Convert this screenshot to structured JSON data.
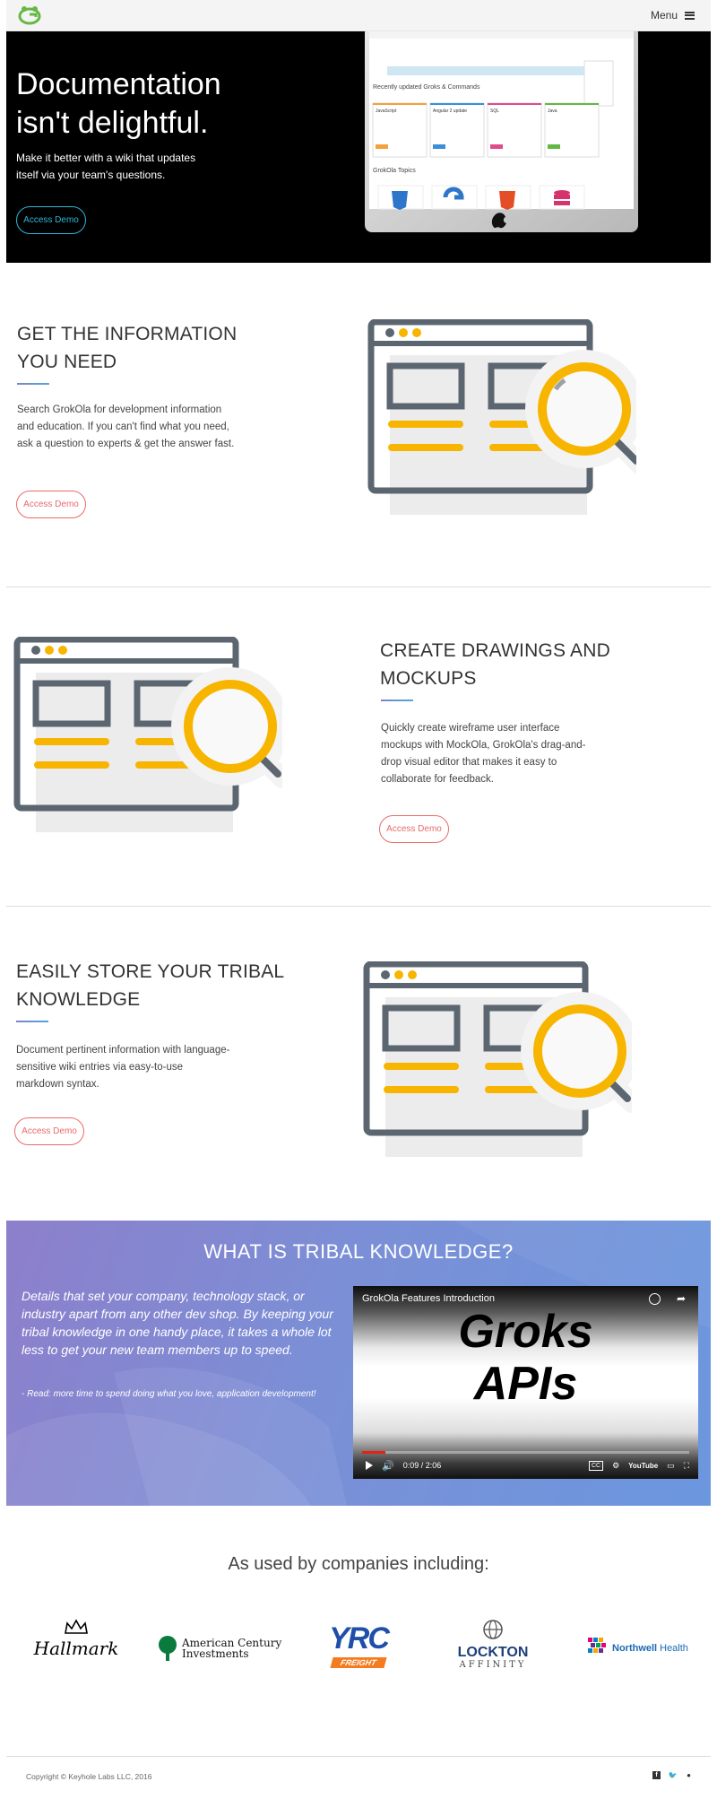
{
  "nav": {
    "menu_label": "Menu"
  },
  "hero": {
    "title_line1": "Documentation",
    "title_line2": "isn't delightful.",
    "subtitle": "Make it better with a wiki that updates itself via your team's questions.",
    "cta_label": "Access Demo",
    "screen": {
      "section_heading": "Recently updated Groks & Commands",
      "topics_heading": "GrokOla Topics",
      "cards": [
        "JavaScript",
        "Angular 2 update",
        "SQL",
        "Java"
      ]
    }
  },
  "features": [
    {
      "title_line1": "GET THE INFORMATION",
      "title_line2": "YOU NEED",
      "text": "Search GrokOla for development information and education. If you can't find what you need, ask a question to experts & get the answer fast.",
      "cta_label": "Access Demo"
    },
    {
      "title_line1": "CREATE DRAWINGS AND",
      "title_line2": "MOCKUPS",
      "text": "Quickly create wireframe user interface mockups with MockOla, GrokOla's drag-and-drop visual editor that makes it easy to collaborate for feedback.",
      "cta_label": "Access Demo"
    },
    {
      "title_line1": "EASILY STORE YOUR TRIBAL",
      "title_line2": "KNOWLEDGE",
      "text": "Document pertinent information with language-sensitive wiki entries via easy-to-use markdown syntax.",
      "cta_label": "Access Demo"
    }
  ],
  "tribal": {
    "title": "WHAT IS TRIBAL KNOWLEDGE?",
    "text": "Details that set your company, technology stack, or industry apart from any other dev shop. By keeping your tribal knowledge in one handy place, it takes a whole lot less to get your new team members up to speed.",
    "note": "- Read: more time to spend doing what you love, application development!",
    "video": {
      "title": "GrokOla Features Introduction",
      "big_line1": "Groks",
      "big_line2": "APIs",
      "time": "0:09 / 2:06",
      "progress": 0.07,
      "cc_label": "CC",
      "brand": "YouTube"
    }
  },
  "companies": {
    "title": "As used by companies including:",
    "logos": [
      {
        "name": "Hallmark"
      },
      {
        "line1": "American Century",
        "line2": "Investments"
      },
      {
        "main": "YRC",
        "sub": "FREIGHT"
      },
      {
        "main": "LOCKTON",
        "sub": "AFFINITY"
      },
      {
        "main": "Northwell",
        "sub": "Health"
      }
    ]
  },
  "footer": {
    "copyright": "Copyright © Keyhole Labs LLC, 2016",
    "social": [
      "facebook-icon",
      "twitter-icon",
      "github-icon"
    ]
  },
  "colors": {
    "accent_teal": "#2bb7d6",
    "demo_red": "#ea6a6a",
    "magnifier_yellow": "#f7b500",
    "illus_gray": "#5b6670",
    "brand_green": "#66b845"
  }
}
